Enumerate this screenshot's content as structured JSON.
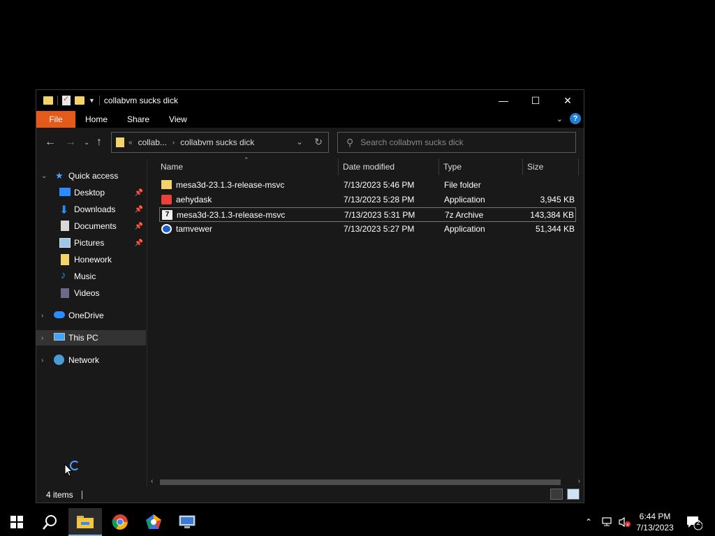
{
  "window": {
    "title": "collabvm sucks dick",
    "controls": {
      "minimize": "—",
      "maximize": "☐",
      "close": "✕"
    }
  },
  "ribbon": {
    "tabs": [
      "File",
      "Home",
      "Share",
      "View"
    ],
    "help": "?"
  },
  "address": {
    "overflow": "«",
    "segments": [
      "collab...",
      "collabvm sucks dick"
    ],
    "search_placeholder": "Search collabvm sucks dick"
  },
  "sidebar": {
    "quick_access": "Quick access",
    "items": [
      {
        "label": "Desktop",
        "icon": "desktop-icon",
        "pinned": true
      },
      {
        "label": "Downloads",
        "icon": "downloads-icon",
        "pinned": true
      },
      {
        "label": "Documents",
        "icon": "documents-icon",
        "pinned": true
      },
      {
        "label": "Pictures",
        "icon": "pictures-icon",
        "pinned": true
      },
      {
        "label": "Honework",
        "icon": "folder-icon",
        "pinned": false
      },
      {
        "label": "Music",
        "icon": "music-icon",
        "pinned": false
      },
      {
        "label": "Videos",
        "icon": "videos-icon",
        "pinned": false
      }
    ],
    "onedrive": "OneDrive",
    "this_pc": "This PC",
    "network": "Network"
  },
  "columns": {
    "name": "Name",
    "date": "Date modified",
    "type": "Type",
    "size": "Size"
  },
  "files": [
    {
      "name": "mesa3d-23.1.3-release-msvc",
      "date": "7/13/2023 5:46 PM",
      "type": "File folder",
      "size": "",
      "icon": "folder-icon"
    },
    {
      "name": "aehydask",
      "date": "7/13/2023 5:28 PM",
      "type": "Application",
      "size": "3,945 KB",
      "icon": "anydesk-icon"
    },
    {
      "name": "mesa3d-23.1.3-release-msvc",
      "date": "7/13/2023 5:31 PM",
      "type": "7z Archive",
      "size": "143,384 KB",
      "icon": "7z-archive-icon"
    },
    {
      "name": "tamvewer",
      "date": "7/13/2023 5:27 PM",
      "type": "Application",
      "size": "51,344 KB",
      "icon": "teamviewer-icon"
    }
  ],
  "status": {
    "count": "4 items"
  },
  "taskbar": {
    "time": "6:44 PM",
    "date": "7/13/2023",
    "notifications": "2"
  }
}
